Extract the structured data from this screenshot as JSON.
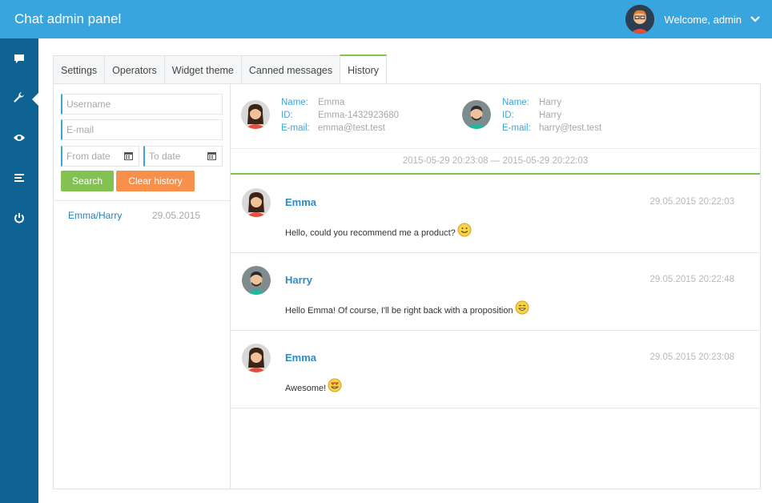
{
  "app": {
    "title": "Chat admin panel",
    "welcome": "Welcome, admin"
  },
  "colors": {
    "header": "#39a5de",
    "sidebar": "#0f6392",
    "accent_green": "#82c152",
    "accent_orange": "#f7904a",
    "link": "#2f8bc7"
  },
  "sidebar": {
    "icons": [
      "chat-icon",
      "wrench-icon",
      "eye-icon",
      "list-icon",
      "power-icon"
    ],
    "active": "wrench-icon"
  },
  "tabs": [
    {
      "label": "Settings"
    },
    {
      "label": "Operators"
    },
    {
      "label": "Widget theme"
    },
    {
      "label": "Canned messages"
    },
    {
      "label": "History",
      "active": true
    }
  ],
  "filters": {
    "username_placeholder": "Username",
    "email_placeholder": "E-mail",
    "from_date_placeholder": "From date",
    "to_date_placeholder": "To date",
    "search_label": "Search",
    "clear_label": "Clear history"
  },
  "history_list": [
    {
      "name": "Emma/Harry",
      "date": "29.05.2015"
    }
  ],
  "participants": [
    {
      "name_label": "Name:",
      "name": "Emma",
      "id_label": "ID:",
      "id": "Emma-1432923680",
      "email_label": "E-mail:",
      "email": "emma@test.test"
    },
    {
      "name_label": "Name:",
      "name": "Harry",
      "id_label": "ID:",
      "id": "Harry",
      "email_label": "E-mail:",
      "email": "harry@test.test"
    }
  ],
  "range": "2015-05-29 20:23:08 — 2015-05-29 20:22:03",
  "messages": [
    {
      "author": "Emma",
      "time": "29.05.2015 20:22:03",
      "text": "Hello, could you recommend me a product?",
      "emoji": "smile-emoji"
    },
    {
      "author": "Harry",
      "time": "29.05.2015 20:22:48",
      "text": "Hello Emma! Of course, I'll be right back with a proposition",
      "emoji": "grin-emoji"
    },
    {
      "author": "Emma",
      "time": "29.05.2015 20:23:08",
      "text": "Awesome!",
      "emoji": "heart-eyes-emoji"
    }
  ]
}
